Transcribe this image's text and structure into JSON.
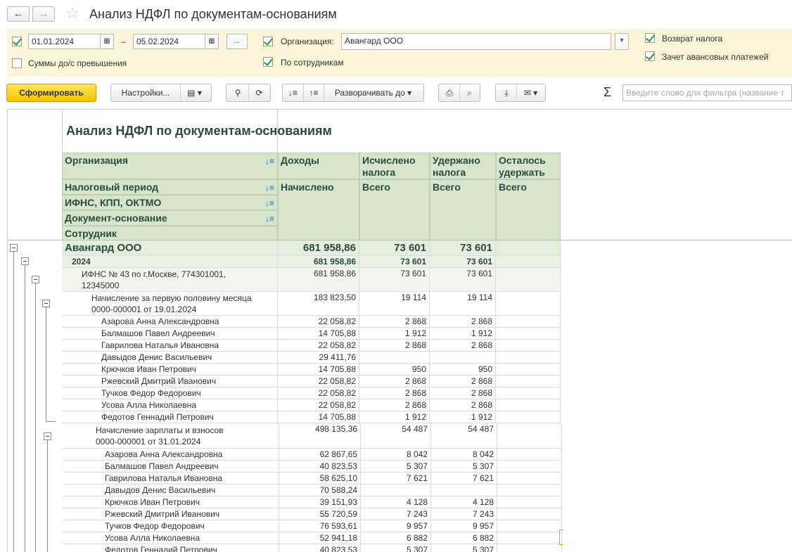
{
  "window": {
    "title": "Анализ НДФЛ по документам-основаниям",
    "back_label": "←",
    "forward_label": "→",
    "favorite_icon": "star-icon"
  },
  "params": {
    "date_from": "01.01.2024",
    "date_to": "05.02.2024",
    "dash": "–",
    "period_button": "...",
    "calendar_icon": "▦",
    "org_label": "Организация:",
    "org_value": "Авангард ООО",
    "dropdown_glyph": "▾",
    "amounts_label": "Суммы до/с превышения",
    "by_employees_label": "По сотрудникам",
    "tax_refund_label": "Возврат налога",
    "advance_offset_label": "Зачет авансовых платежей",
    "checks": {
      "period": true,
      "amounts": false,
      "org": true,
      "by_employees": true,
      "tax_refund": true,
      "advance_offset": true
    }
  },
  "toolbar": {
    "generate_label": "Сформировать",
    "settings_label": "Настройки...",
    "expand_to_label": "Разворачивать до",
    "filter_placeholder": "Введите слово для фильтра (название т",
    "sigma": "Σ",
    "icons": [
      "variants-icon",
      "search-icon",
      "search-replace-icon",
      "sort-desc-icon",
      "sort-asc-icon",
      "print-icon",
      "preview-icon",
      "download-icon",
      "mail-icon"
    ]
  },
  "report": {
    "title": "Анализ НДФЛ по документам-основаниям",
    "headers": {
      "organization": "Организация",
      "tax_period": "Налоговый период",
      "ifns": "ИФНС, КПП, ОКТМО",
      "document": "Документ-основание",
      "employee": "Сотрудник",
      "income": "Доходы",
      "calculated": "Исчислено налога",
      "withheld": "Удержано налога",
      "remaining": "Осталось удержать",
      "accrued": "Начислено",
      "total1": "Всего",
      "total2": "Всего",
      "total3": "Всего"
    },
    "rows": [
      {
        "label": "Авангард ООО",
        "income": "681 958,86",
        "calc": "73 601",
        "withheld": "73 601",
        "remain": ""
      },
      {
        "label": "2024",
        "income": "681 958,86",
        "calc": "73 601",
        "withheld": "73 601",
        "remain": ""
      },
      {
        "label": "ИФНС № 43 по г.Москве, 774301001,",
        "label2": "12345000",
        "income": "681 958,86",
        "calc": "73 601",
        "withheld": "73 601",
        "remain": ""
      },
      {
        "label": "Начисление за первую половину месяца",
        "label2": "0000-000001 от 19.01.2024",
        "income": "183 823,50",
        "calc": "19 114",
        "withheld": "19 114",
        "remain": ""
      },
      {
        "label": "Азарова Анна Александровна",
        "income": "22 058,82",
        "calc": "2 868",
        "withheld": "2 868",
        "remain": ""
      },
      {
        "label": "Балмашов Павел Андреевич",
        "income": "14 705,88",
        "calc": "1 912",
        "withheld": "1 912",
        "remain": ""
      },
      {
        "label": "Гаврилова Наталья Ивановна",
        "income": "22 058,82",
        "calc": "2 868",
        "withheld": "2 868",
        "remain": ""
      },
      {
        "label": "Давыдов Денис Васильевич",
        "income": "29 411,76",
        "calc": "",
        "withheld": "",
        "remain": ""
      },
      {
        "label": "Крючков Иван Петрович",
        "income": "14 705,88",
        "calc": "950",
        "withheld": "950",
        "remain": ""
      },
      {
        "label": "Ржевский Дмитрий Иванович",
        "income": "22 058,82",
        "calc": "2 868",
        "withheld": "2 868",
        "remain": ""
      },
      {
        "label": "Тучков Федор Федорович",
        "income": "22 058,82",
        "calc": "2 868",
        "withheld": "2 868",
        "remain": ""
      },
      {
        "label": "Усова Алла Николаевна",
        "income": "22 058,82",
        "calc": "2 868",
        "withheld": "2 868",
        "remain": ""
      },
      {
        "label": "Федотов Геннадий Петрович",
        "income": "14 705,88",
        "calc": "1 912",
        "withheld": "1 912",
        "remain": ""
      },
      {
        "label": "Начисление зарплаты и взносов",
        "label2": "0000-000001 от 31.01.2024",
        "income": "498 135,36",
        "calc": "54 487",
        "withheld": "54 487",
        "remain": ""
      },
      {
        "label": "Азарова Анна Александровна",
        "income": "62 867,65",
        "calc": "8 042",
        "withheld": "8 042",
        "remain": ""
      },
      {
        "label": "Балмашов Павел Андреевич",
        "income": "40 823,53",
        "calc": "5 307",
        "withheld": "5 307",
        "remain": ""
      },
      {
        "label": "Гаврилова Наталья Ивановна",
        "income": "58 625,10",
        "calc": "7 621",
        "withheld": "7 621",
        "remain": ""
      },
      {
        "label": "Давыдов Денис Васильевич",
        "income": "70 588,24",
        "calc": "",
        "withheld": "",
        "remain": ""
      },
      {
        "label": "Крючков Иван Петрович",
        "income": "39 151,93",
        "calc": "4 128",
        "withheld": "4 128",
        "remain": ""
      },
      {
        "label": "Ржевский Дмитрий Иванович",
        "income": "55 720,59",
        "calc": "7 243",
        "withheld": "7 243",
        "remain": ""
      },
      {
        "label": "Тучков Федор Федорович",
        "income": "76 593,61",
        "calc": "9 957",
        "withheld": "9 957",
        "remain": ""
      },
      {
        "label": "Усова Алла Николаевна",
        "income": "52 941,18",
        "calc": "6 882",
        "withheld": "6 882",
        "remain": ""
      },
      {
        "label": "Федотов Геннадий Петрович",
        "income": "40 823,53",
        "calc": "5 307",
        "withheld": "5 307",
        "remain": ""
      }
    ]
  }
}
